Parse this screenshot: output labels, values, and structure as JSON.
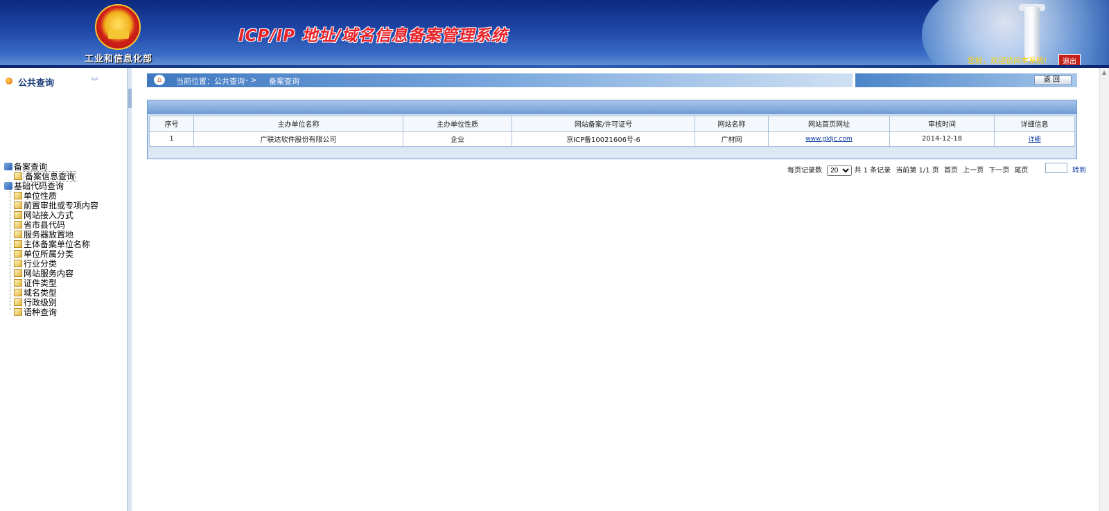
{
  "header": {
    "ministry": "工业和信息化部",
    "title": "ICP/IP 地址/域名信息备案管理系统",
    "welcome": "您好，欢迎访问本系统!",
    "logout_label": "退出"
  },
  "sidebar": {
    "title": "公共查询",
    "collapse_icon": "double-chevron-down-icon",
    "groups": [
      {
        "label": "备案查询",
        "items": [
          "备案信息查询"
        ]
      },
      {
        "label": "基础代码查询",
        "items": [
          "单位性质",
          "前置审批或专项内容",
          "网站接入方式",
          "省市县代码",
          "服务器放置地",
          "主体备案单位名称",
          "单位所属分类",
          "行业分类",
          "网站服务内容",
          "证件类型",
          "域名类型",
          "行政级别",
          "语种查询"
        ]
      }
    ]
  },
  "breadcrumb": {
    "location": "当前位置：公共查询",
    "arrow": "- >",
    "current": "备案查询",
    "back_label": "返回"
  },
  "table": {
    "columns": [
      "序号",
      "主办单位名称",
      "主办单位性质",
      "网站备案/许可证号",
      "网站名称",
      "网站首页网址",
      "审核时间",
      "详细信息"
    ],
    "rows": [
      {
        "index": "1",
        "org": "广联达软件股份有限公司",
        "type": "企业",
        "license": "京ICP备10021606号-6",
        "site_name": "广材网",
        "url": "www.gldjc.com",
        "date": "2014-12-18",
        "detail": "详细"
      }
    ]
  },
  "pager": {
    "per_page_label": "每页记录数",
    "per_page_value": "20",
    "total": "共 1 条记录",
    "current": "当前第 1/1 页",
    "first": "首页",
    "prev": "上一页",
    "next": "下一页",
    "last": "尾页",
    "goto_label": "转到"
  },
  "colors": {
    "header_blue": "#1f47a8",
    "title_red": "#e8242a",
    "table_border": "#a9bfdc",
    "panel_border": "#6e9ad3"
  }
}
